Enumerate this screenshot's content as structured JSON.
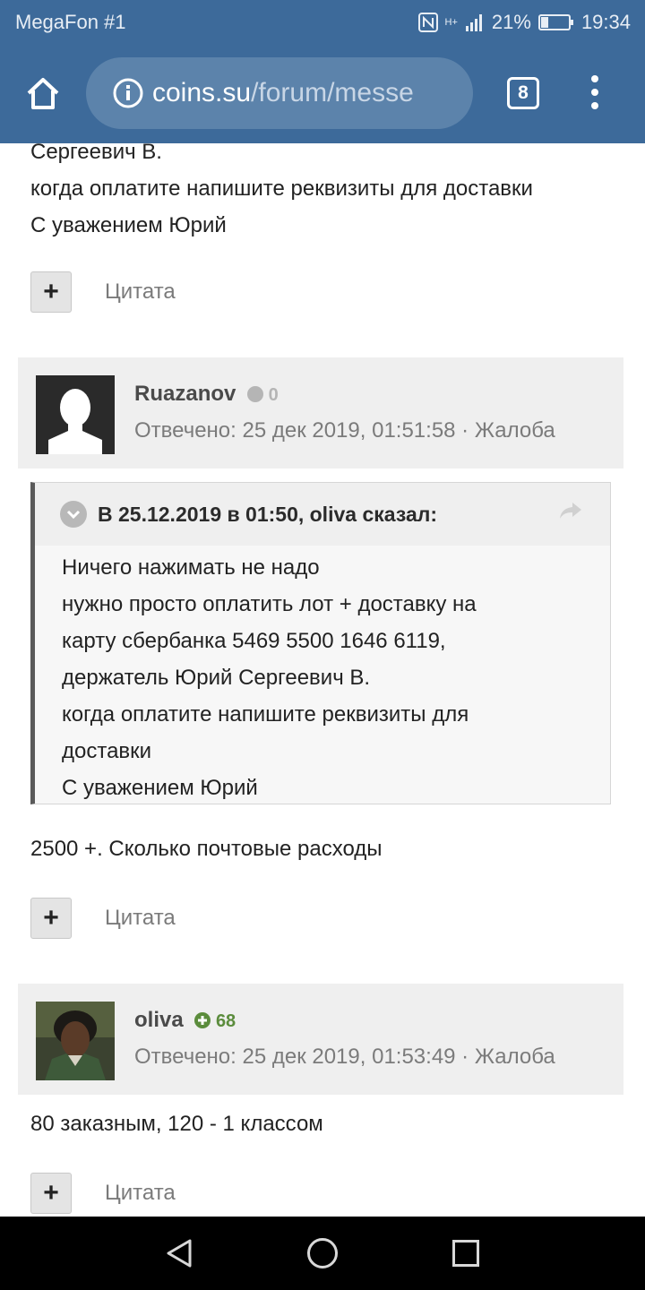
{
  "status_bar": {
    "carrier": "MegaFon #1",
    "network": "H+",
    "battery": "21%",
    "time": "19:34"
  },
  "browser": {
    "url_host": "coins.su",
    "url_path": "/forum/messe",
    "tab_count": "8",
    "icons": [
      "home-icon",
      "info-icon",
      "tabs-icon",
      "menu-icon"
    ]
  },
  "top_text": {
    "line1": "Сергеевич В.",
    "line2": "когда оплатите напишите реквизиты для доставки",
    "line3": "С уважением Юрий"
  },
  "quote_label": "Цитата",
  "plus_label": "+",
  "posts": [
    {
      "username": "Ruazanov",
      "reputation": "0",
      "rep_color": "#b5b5b5",
      "meta": "Отвечено: 25 дек 2019, 01:51:58 · Жалоба",
      "quote": {
        "title": "В 25.12.2019 в 01:50, oliva сказал:",
        "lines": [
          "Ничего нажимать не надо",
          "нужно просто оплатить лот + доставку на",
          "карту сбербанка 5469 5500 1646 6119,",
          "держатель Юрий Сергеевич В.",
          "когда оплатите напишите реквизиты для",
          "доставки",
          "С уважением Юрий"
        ]
      },
      "body": "2500 +. Сколько почтовые расходы"
    },
    {
      "username": "oliva",
      "reputation": "68",
      "rep_color": "#5b8c3c",
      "meta": "Отвечено: 25 дек 2019, 01:53:49 · Жалоба",
      "body": "80 заказным, 120 - 1 классом"
    }
  ]
}
